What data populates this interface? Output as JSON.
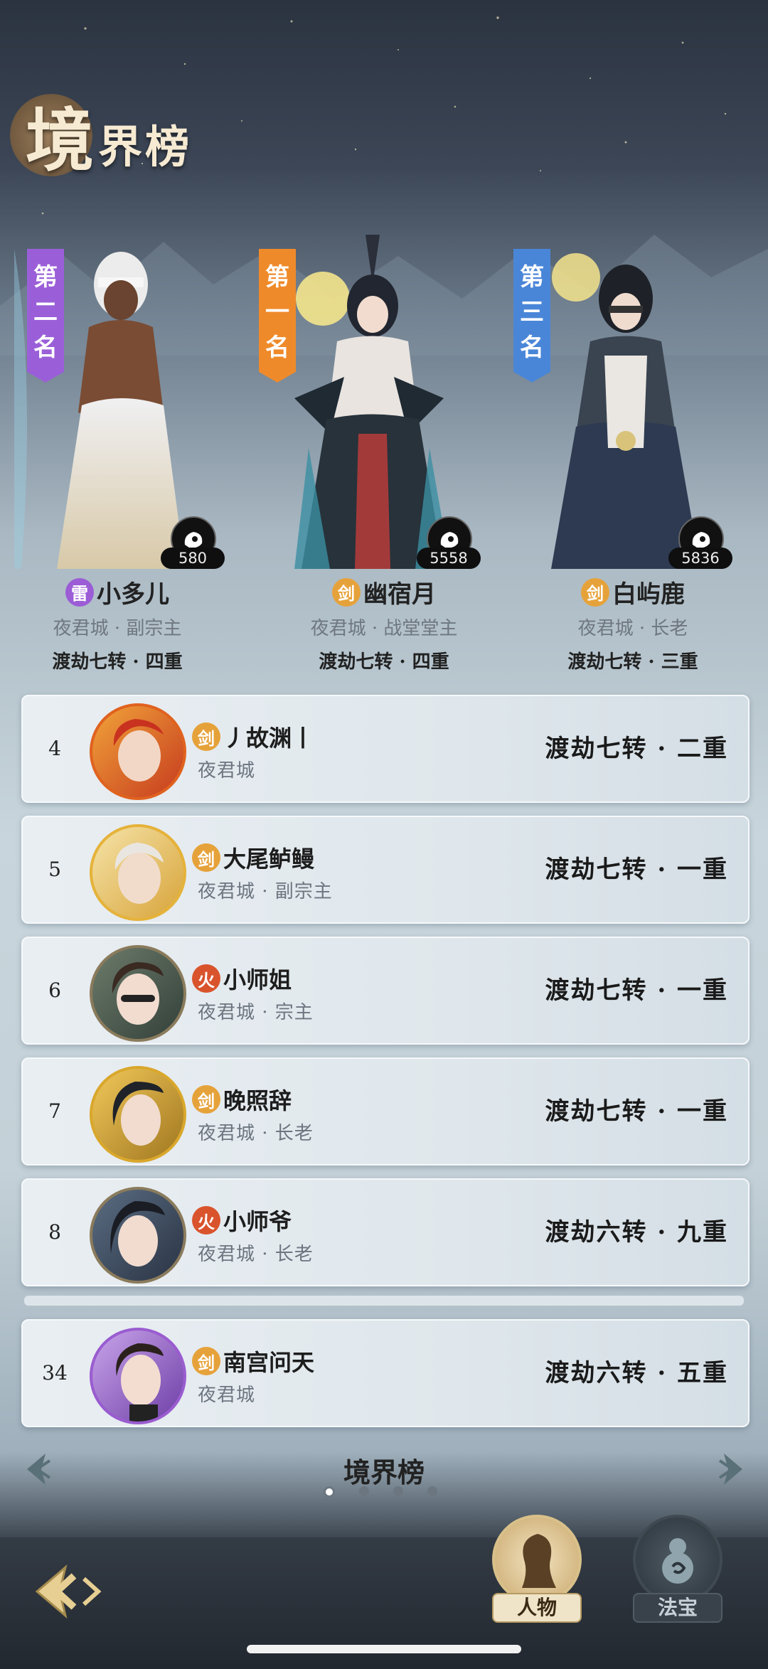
{
  "header": {
    "title_first": "境",
    "title_rest": "界榜"
  },
  "top3": [
    {
      "position": "left",
      "rank_label": "第二名",
      "banner_color": "#9a5fd8",
      "pet_power": "580",
      "element": "雷",
      "element_type": "thunder",
      "name": "小多儿",
      "sect": "夜君城 · 副宗主",
      "realm": "渡劫七转 · 四重"
    },
    {
      "position": "center",
      "rank_label": "第一名",
      "banner_color": "#ef8a2a",
      "pet_power": "5558",
      "element": "剑",
      "element_type": "sword",
      "name": "幽宿月",
      "sect": "夜君城 · 战堂堂主",
      "realm": "渡劫七转 · 四重"
    },
    {
      "position": "right",
      "rank_label": "第三名",
      "banner_color": "#4a86d8",
      "pet_power": "5836",
      "element": "剑",
      "element_type": "sword",
      "name": "白屿鹿",
      "sect": "夜君城 · 长老",
      "realm": "渡劫七转 · 三重"
    }
  ],
  "ranking_rows": [
    {
      "rank": "4",
      "element": "剑",
      "element_type": "sword",
      "name": "丿故渊丨",
      "sect": "夜君城",
      "realm": "渡劫七转 · 二重",
      "avatar_ring": "#e0621f"
    },
    {
      "rank": "5",
      "element": "剑",
      "element_type": "sword",
      "name": "大尾鲈鳗",
      "sect": "夜君城 · 副宗主",
      "realm": "渡劫七转 · 一重",
      "avatar_ring": "#e5b23a"
    },
    {
      "rank": "6",
      "element": "火",
      "element_type": "fire",
      "name": "小师姐",
      "sect": "夜君城 · 宗主",
      "realm": "渡劫七转 · 一重",
      "avatar_ring": "#8a7b5c"
    },
    {
      "rank": "7",
      "element": "剑",
      "element_type": "sword",
      "name": "晚照辞",
      "sect": "夜君城 · 长老",
      "realm": "渡劫七转 · 一重",
      "avatar_ring": "#d9a72c"
    },
    {
      "rank": "8",
      "element": "火",
      "element_type": "fire",
      "name": "小师爷",
      "sect": "夜君城 · 长老",
      "realm": "渡劫六转 · 九重",
      "avatar_ring": "#8a7b5c"
    }
  ],
  "my_row": {
    "rank": "34",
    "element": "剑",
    "element_type": "sword",
    "name": "南宫问天",
    "sect": "夜君城",
    "realm": "渡劫六转 · 五重",
    "avatar_ring": "#9a5cd0"
  },
  "footer": {
    "title": "境界榜",
    "pages": 4,
    "active_page": 1
  },
  "bottom_tabs": [
    {
      "label": "人物",
      "active": true
    },
    {
      "label": "法宝",
      "active": false
    }
  ]
}
